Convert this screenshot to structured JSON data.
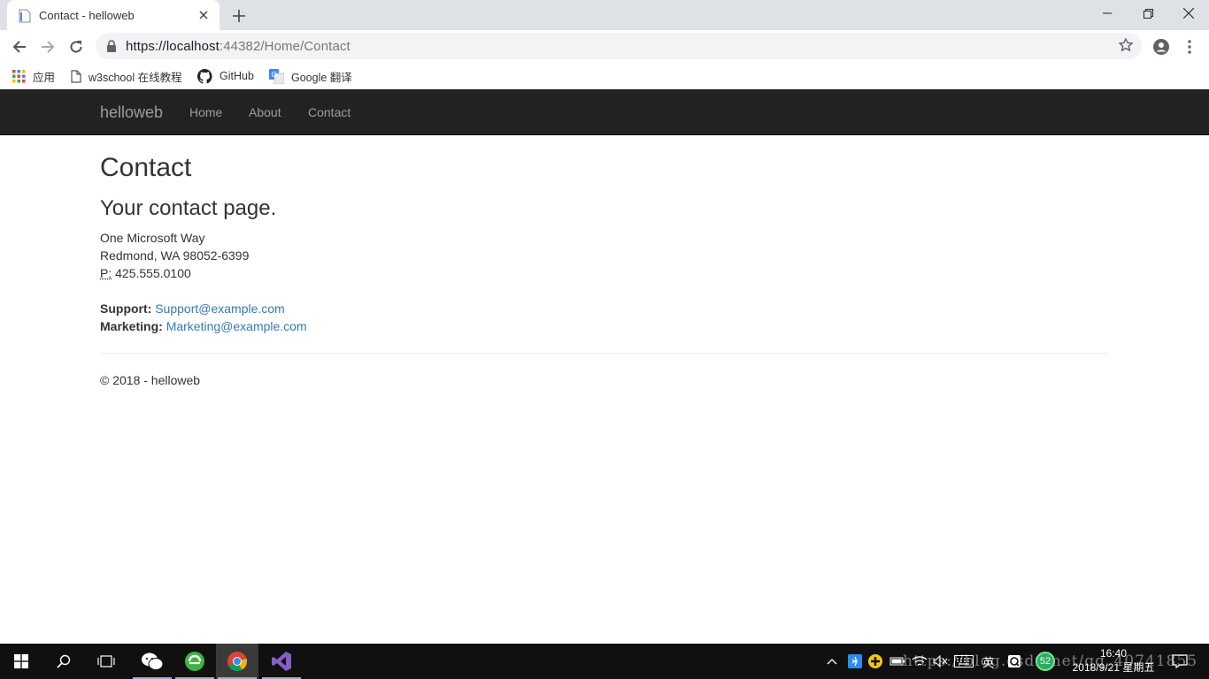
{
  "browser": {
    "tab_title": "Contact - helloweb",
    "url_host": "https://localhost",
    "url_rest": ":44382/Home/Contact",
    "bookmarks": [
      {
        "label": "应用",
        "icon": "apps-grid-icon"
      },
      {
        "label": "w3school 在线教程",
        "icon": "page-icon"
      },
      {
        "label": "GitHub",
        "icon": "github-icon"
      },
      {
        "label": "Google 翻译",
        "icon": "google-translate-icon"
      }
    ]
  },
  "navbar": {
    "brand": "helloweb",
    "links": [
      "Home",
      "About",
      "Contact"
    ]
  },
  "page": {
    "title": "Contact",
    "subtitle": "Your contact page.",
    "address_line1": "One Microsoft Way",
    "address_line2": "Redmond, WA 98052-6399",
    "phone_abbr": "P:",
    "phone": "425.555.0100",
    "support_label": "Support:",
    "support_email": "Support@example.com",
    "marketing_label": "Marketing:",
    "marketing_email": "Marketing@example.com",
    "footer": "© 2018 - helloweb"
  },
  "taskbar": {
    "ime": "英",
    "badge": "52",
    "time": "16:40",
    "date": "2018/9/21 星期五",
    "watermark": "https://blog.csdn.net/qq_40741855"
  },
  "colors": {
    "navbar_bg": "#222222",
    "navbar_text": "#9d9d9d",
    "link": "#337ab7"
  }
}
